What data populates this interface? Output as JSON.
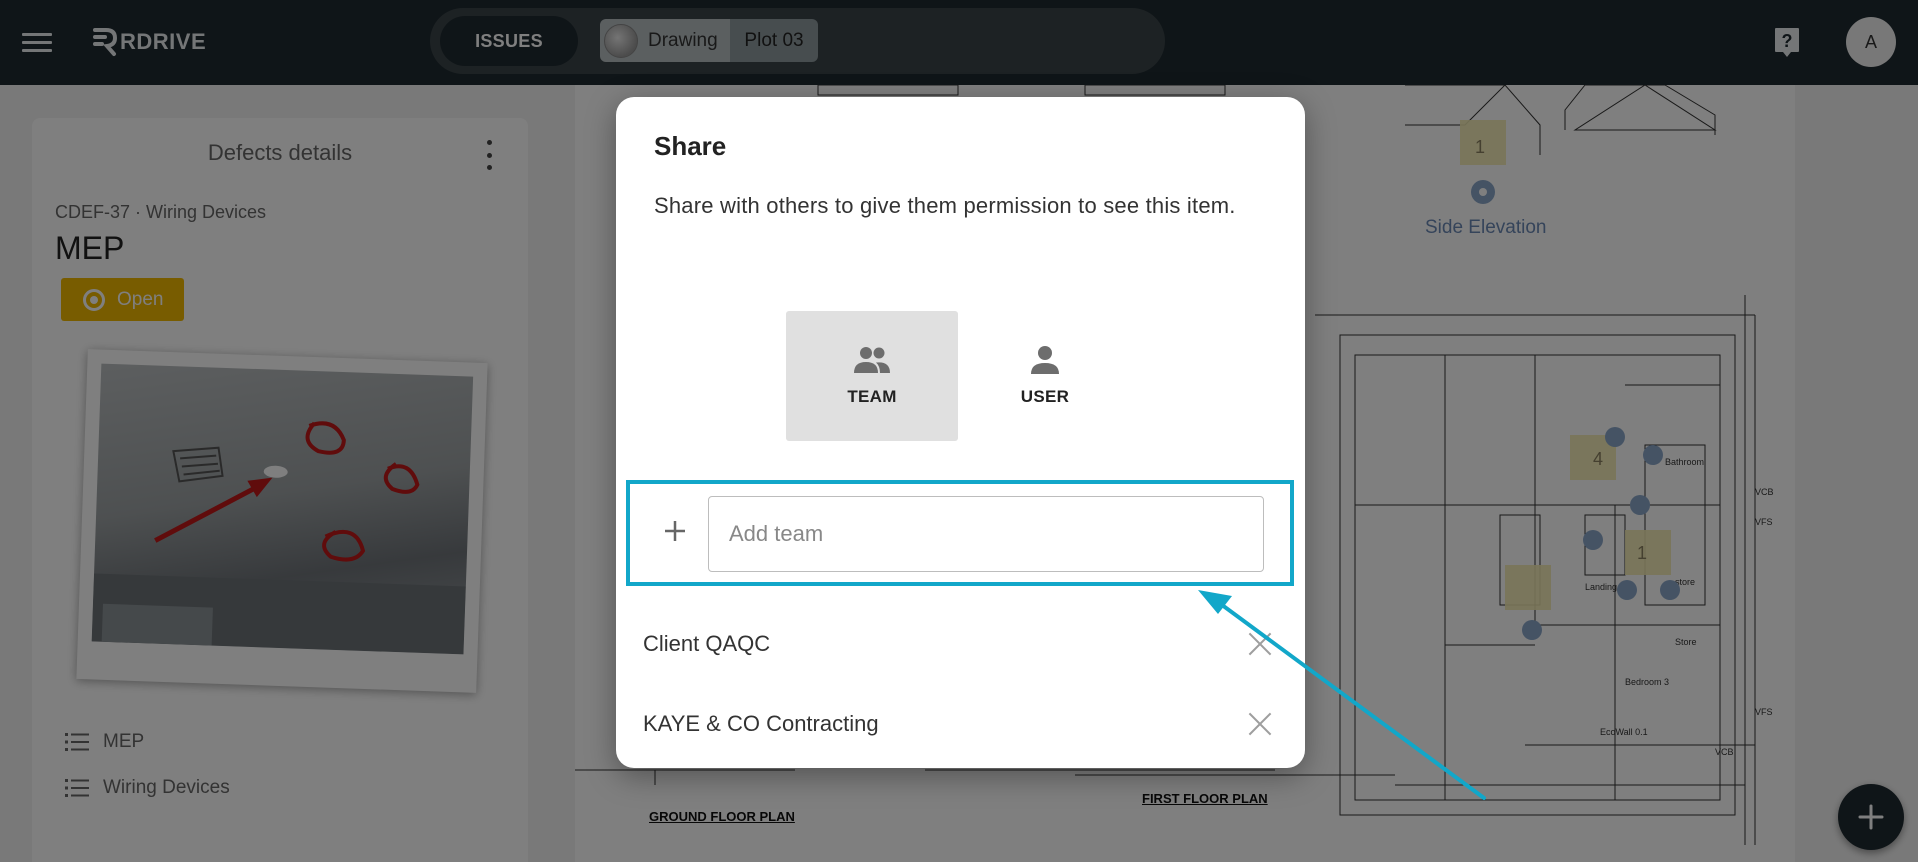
{
  "app": {
    "brand": "RDRIVE"
  },
  "topbar": {
    "issues_label": "ISSUES",
    "drawing_label": "Drawing",
    "plot_label": "Plot 03",
    "avatar_initial": "A"
  },
  "left_panel": {
    "title": "Defects details",
    "defect_code": "CDEF-37 · Wiring Devices",
    "defect_name": "MEP",
    "status": "Open",
    "status_color": "#f1b800",
    "categories": [
      "MEP",
      "Wiring Devices"
    ]
  },
  "drawing": {
    "labels": [
      "GROUND FLOOR PLAN",
      "FIRST FLOOR PLAN",
      "Side Elevation"
    ],
    "markers": [
      "1",
      "4",
      "1"
    ]
  },
  "dialog": {
    "title": "Share",
    "description": "Share with others to give them permission to see this item.",
    "tabs": [
      {
        "label": "TEAM",
        "icon": "team-icon",
        "selected": true
      },
      {
        "label": "USER",
        "icon": "user-icon",
        "selected": false
      }
    ],
    "add_placeholder": "Add team",
    "add_value": "",
    "shared_teams": [
      "Client QAQC",
      "KAYE & CO Contracting"
    ]
  },
  "colors": {
    "accent_highlight": "#12a7c9",
    "topbar_bg": "#1f2a30"
  }
}
